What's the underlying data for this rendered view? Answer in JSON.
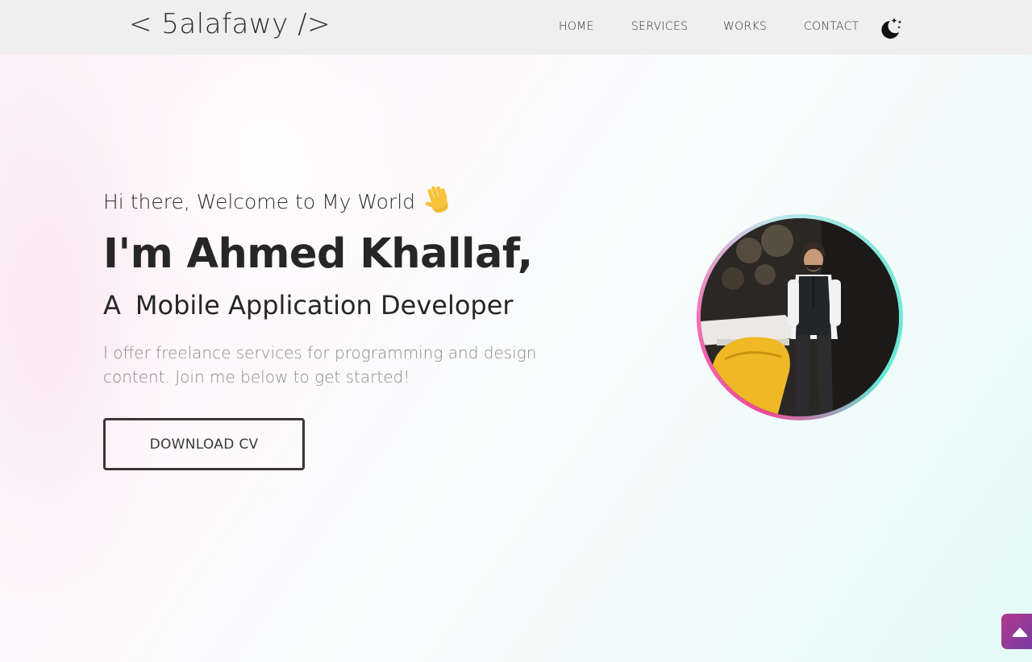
{
  "header": {
    "logo": "< 5alafawy />",
    "nav": [
      {
        "label": "HOME"
      },
      {
        "label": "SERVICES"
      },
      {
        "label": "WORKS"
      },
      {
        "label": "CONTACT"
      }
    ],
    "theme_toggle_icon": "moon-stars-icon"
  },
  "hero": {
    "greeting": "Hi there, Welcome to My World",
    "wave_icon": "waving-hand-icon",
    "name": "I'm Ahmed Khallaf,",
    "role_prefix": "A",
    "role": "Mobile Application Developer",
    "tagline": "I offer freelance services for programming and design content. Join me below to get started!",
    "cv_button": "DOWNLOAD CV"
  },
  "profile_image": {
    "alt_semantic": "profile-photo",
    "ring_colors": [
      "#ec4899",
      "#5eead4"
    ]
  },
  "scroll_top": {
    "icon": "arrow-up-icon",
    "colors": [
      "#b23a8a",
      "#6d3aa8"
    ]
  },
  "colors": {
    "navbar_bg": "#efefef",
    "text_dark": "#262626",
    "text_muted": "#8a8a8a",
    "button_border": "#3d3434"
  }
}
